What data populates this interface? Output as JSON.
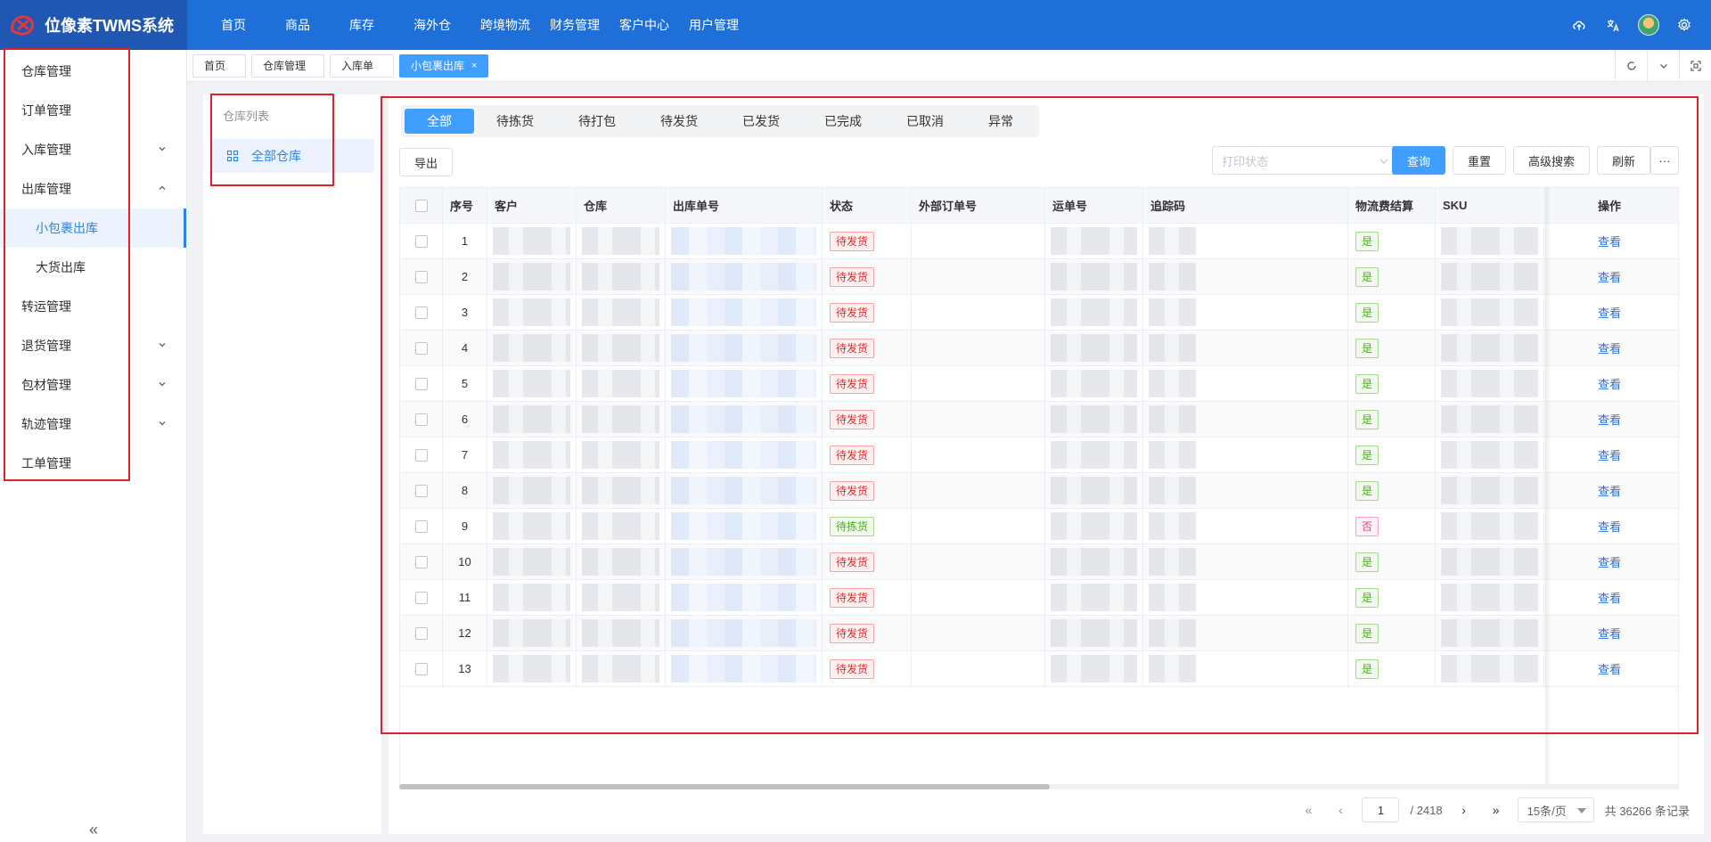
{
  "app": {
    "title": "位像素TWMS系统"
  },
  "topnav": [
    "首页",
    "商品",
    "库存",
    "海外仓",
    "跨境物流",
    "财务管理",
    "客户中心",
    "用户管理"
  ],
  "topright_icons": [
    "cloud-upload-icon",
    "translate-icon",
    "avatar",
    "gear-icon"
  ],
  "sidebar": {
    "items": [
      {
        "label": "仓库管理",
        "chevron": ""
      },
      {
        "label": "订单管理",
        "chevron": ""
      },
      {
        "label": "入库管理",
        "chevron": "down"
      },
      {
        "label": "出库管理",
        "chevron": "up"
      },
      {
        "label": "小包裹出库",
        "sub": true,
        "active": true
      },
      {
        "label": "大货出库",
        "sub": true
      },
      {
        "label": "转运管理",
        "chevron": ""
      },
      {
        "label": "退货管理",
        "chevron": "down"
      },
      {
        "label": "包材管理",
        "chevron": "down"
      },
      {
        "label": "轨迹管理",
        "chevron": "down"
      },
      {
        "label": "工单管理",
        "chevron": ""
      }
    ],
    "collapse_label": "«"
  },
  "page_tabs": [
    {
      "label": "首页"
    },
    {
      "label": "仓库管理"
    },
    {
      "label": "入库单"
    },
    {
      "label": "小包裹出库",
      "active": true,
      "close": "×"
    }
  ],
  "warehouse_list": {
    "title": "仓库列表",
    "item": "全部仓库"
  },
  "status_tabs": [
    "全部",
    "待拣货",
    "待打包",
    "待发货",
    "已发货",
    "已完成",
    "已取消",
    "异常"
  ],
  "toolbar": {
    "export": "导出",
    "print_status_placeholder": "打印状态",
    "query": "查询",
    "reset": "重置",
    "advanced": "高级搜索",
    "refresh": "刷新",
    "more": "···"
  },
  "table": {
    "headers": [
      "序号",
      "客户",
      "仓库",
      "出库单号",
      "状态",
      "外部订单号",
      "运单号",
      "追踪码",
      "物流费结算",
      "SKU",
      "操作"
    ],
    "rows": [
      {
        "no": "1",
        "status": "待发货",
        "settle": "是",
        "action": "查看"
      },
      {
        "no": "2",
        "status": "待发货",
        "settle": "是",
        "action": "查看"
      },
      {
        "no": "3",
        "status": "待发货",
        "settle": "是",
        "action": "查看"
      },
      {
        "no": "4",
        "status": "待发货",
        "settle": "是",
        "action": "查看"
      },
      {
        "no": "5",
        "status": "待发货",
        "settle": "是",
        "action": "查看"
      },
      {
        "no": "6",
        "status": "待发货",
        "settle": "是",
        "action": "查看"
      },
      {
        "no": "7",
        "status": "待发货",
        "settle": "是",
        "action": "查看"
      },
      {
        "no": "8",
        "status": "待发货",
        "settle": "是",
        "action": "查看"
      },
      {
        "no": "9",
        "status": "待拣货",
        "settle": "否",
        "action": "查看"
      },
      {
        "no": "10",
        "status": "待发货",
        "settle": "是",
        "action": "查看"
      },
      {
        "no": "11",
        "status": "待发货",
        "settle": "是",
        "action": "查看"
      },
      {
        "no": "12",
        "status": "待发货",
        "settle": "是",
        "action": "查看"
      },
      {
        "no": "13",
        "status": "待发货",
        "settle": "是",
        "action": "查看"
      }
    ]
  },
  "pagination": {
    "current_page": "1",
    "total_pages": "/ 2418",
    "page_size": "15条/页",
    "total": "共 36266 条记录"
  },
  "colors": {
    "primary": "#409eff",
    "topbar": "#1f6fd8",
    "highlight": "#e0202a"
  }
}
